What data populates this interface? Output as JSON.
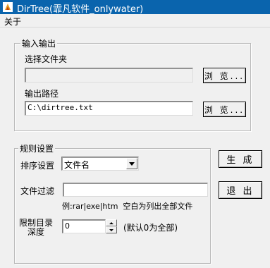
{
  "window": {
    "title": "DirTree(霏凡软件_onlywater)",
    "icon": "app-icon"
  },
  "menu": {
    "about": "关于"
  },
  "io_group": {
    "legend": "输入输出",
    "folder_label": "选择文件夹",
    "folder_value": "",
    "browse_label": "浏 览...",
    "output_label": "输出路径",
    "output_value": "C:\\dirtree.txt",
    "browse2_label": "浏 览..."
  },
  "rules_group": {
    "legend": "规则设置",
    "sort_label": "排序设置",
    "sort_value": "文件名",
    "filter_label": "文件过滤",
    "filter_value": "",
    "filter_hint": "例:rar|exe|htm  空白为列出全部文件",
    "depth_label_line1": "限制目录",
    "depth_label_line2": "深度",
    "depth_value": "0",
    "depth_hint": "(默认0为全部)"
  },
  "actions": {
    "generate_label": "生 成",
    "exit_label": "退 出"
  },
  "colors": {
    "titlebar": "#0a64ad",
    "face": "#f0f0f0"
  }
}
